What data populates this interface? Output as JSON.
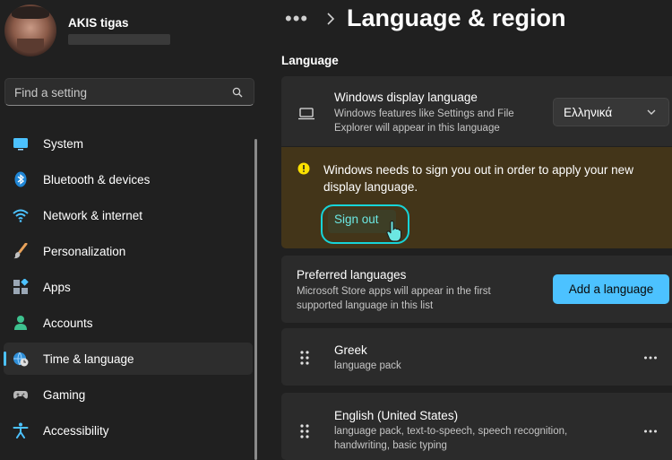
{
  "user": {
    "name": "AKIS tigas"
  },
  "search": {
    "placeholder": "Find a setting"
  },
  "sidebar": {
    "items": [
      {
        "label": "System",
        "icon": "monitor-icon"
      },
      {
        "label": "Bluetooth & devices",
        "icon": "bluetooth-icon"
      },
      {
        "label": "Network & internet",
        "icon": "wifi-icon"
      },
      {
        "label": "Personalization",
        "icon": "brush-icon"
      },
      {
        "label": "Apps",
        "icon": "apps-icon"
      },
      {
        "label": "Accounts",
        "icon": "person-icon"
      },
      {
        "label": "Time & language",
        "icon": "globe-clock-icon",
        "active": true
      },
      {
        "label": "Gaming",
        "icon": "gamepad-icon"
      },
      {
        "label": "Accessibility",
        "icon": "accessibility-icon"
      }
    ]
  },
  "header": {
    "more": "•••",
    "title": "Language & region"
  },
  "main": {
    "section_label": "Language",
    "display_language": {
      "title": "Windows display language",
      "description_line1": "Windows features like Settings and File",
      "description_line2": "Explorer will appear in this language",
      "selected": "Ελληνικά"
    },
    "warning": {
      "text": "Windows needs to sign you out in order to apply your new display language.",
      "button": "Sign out"
    },
    "preferred": {
      "title": "Preferred languages",
      "description_line1": "Microsoft Store apps will appear in the first",
      "description_line2": "supported language in this list",
      "button": "Add a language"
    },
    "languages": [
      {
        "name": "Greek",
        "detail_line1": "language pack",
        "detail_line2": ""
      },
      {
        "name": "English (United States)",
        "detail_line1": "language pack, text-to-speech, speech recognition,",
        "detail_line2": "handwriting, basic typing"
      }
    ]
  },
  "colors": {
    "accent": "#4cc2ff",
    "warning_bg": "#433519",
    "highlight_ring": "#17d4d8"
  }
}
